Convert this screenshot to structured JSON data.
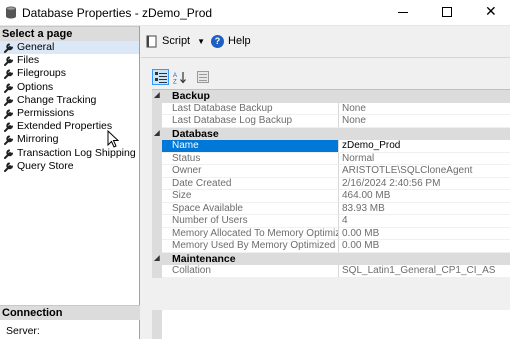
{
  "window": {
    "title": "Database Properties - zDemo_Prod",
    "close_glyph": "✕"
  },
  "sidebar": {
    "header": "Select a page",
    "items": [
      {
        "label": "General",
        "active": true
      },
      {
        "label": "Files"
      },
      {
        "label": "Filegroups"
      },
      {
        "label": "Options"
      },
      {
        "label": "Change Tracking"
      },
      {
        "label": "Permissions"
      },
      {
        "label": "Extended Properties"
      },
      {
        "label": "Mirroring"
      },
      {
        "label": "Transaction Log Shipping"
      },
      {
        "label": "Query Store"
      }
    ],
    "connection_header": "Connection",
    "server_label": "Server:"
  },
  "toolbar": {
    "script_label": "Script",
    "help_label": "Help",
    "help_glyph": "?"
  },
  "property_grid": {
    "categories": [
      {
        "name": "Backup",
        "rows": [
          {
            "name": "Last Database Backup",
            "value": "None"
          },
          {
            "name": "Last Database Log Backup",
            "value": "None"
          }
        ]
      },
      {
        "name": "Database",
        "rows": [
          {
            "name": "Name",
            "value": "zDemo_Prod",
            "selected": true
          },
          {
            "name": "Status",
            "value": "Normal"
          },
          {
            "name": "Owner",
            "value": "ARISTOTLE\\SQLCloneAgent"
          },
          {
            "name": "Date Created",
            "value": "2/16/2024 2:40:56 PM"
          },
          {
            "name": "Size",
            "value": "464.00 MB"
          },
          {
            "name": "Space Available",
            "value": "83.93 MB"
          },
          {
            "name": "Number of Users",
            "value": "4"
          },
          {
            "name": "Memory Allocated To Memory Optimized Objects",
            "value": "0.00 MB"
          },
          {
            "name": "Memory Used By Memory Optimized Objects",
            "value": "0.00 MB"
          }
        ]
      },
      {
        "name": "Maintenance",
        "rows": [
          {
            "name": "Collation",
            "value": "SQL_Latin1_General_CP1_CI_AS"
          }
        ]
      }
    ]
  },
  "colors": {
    "selection": "#0078d7",
    "category_bg": "#dcdcdc",
    "help_blue": "#1e5fc4"
  }
}
